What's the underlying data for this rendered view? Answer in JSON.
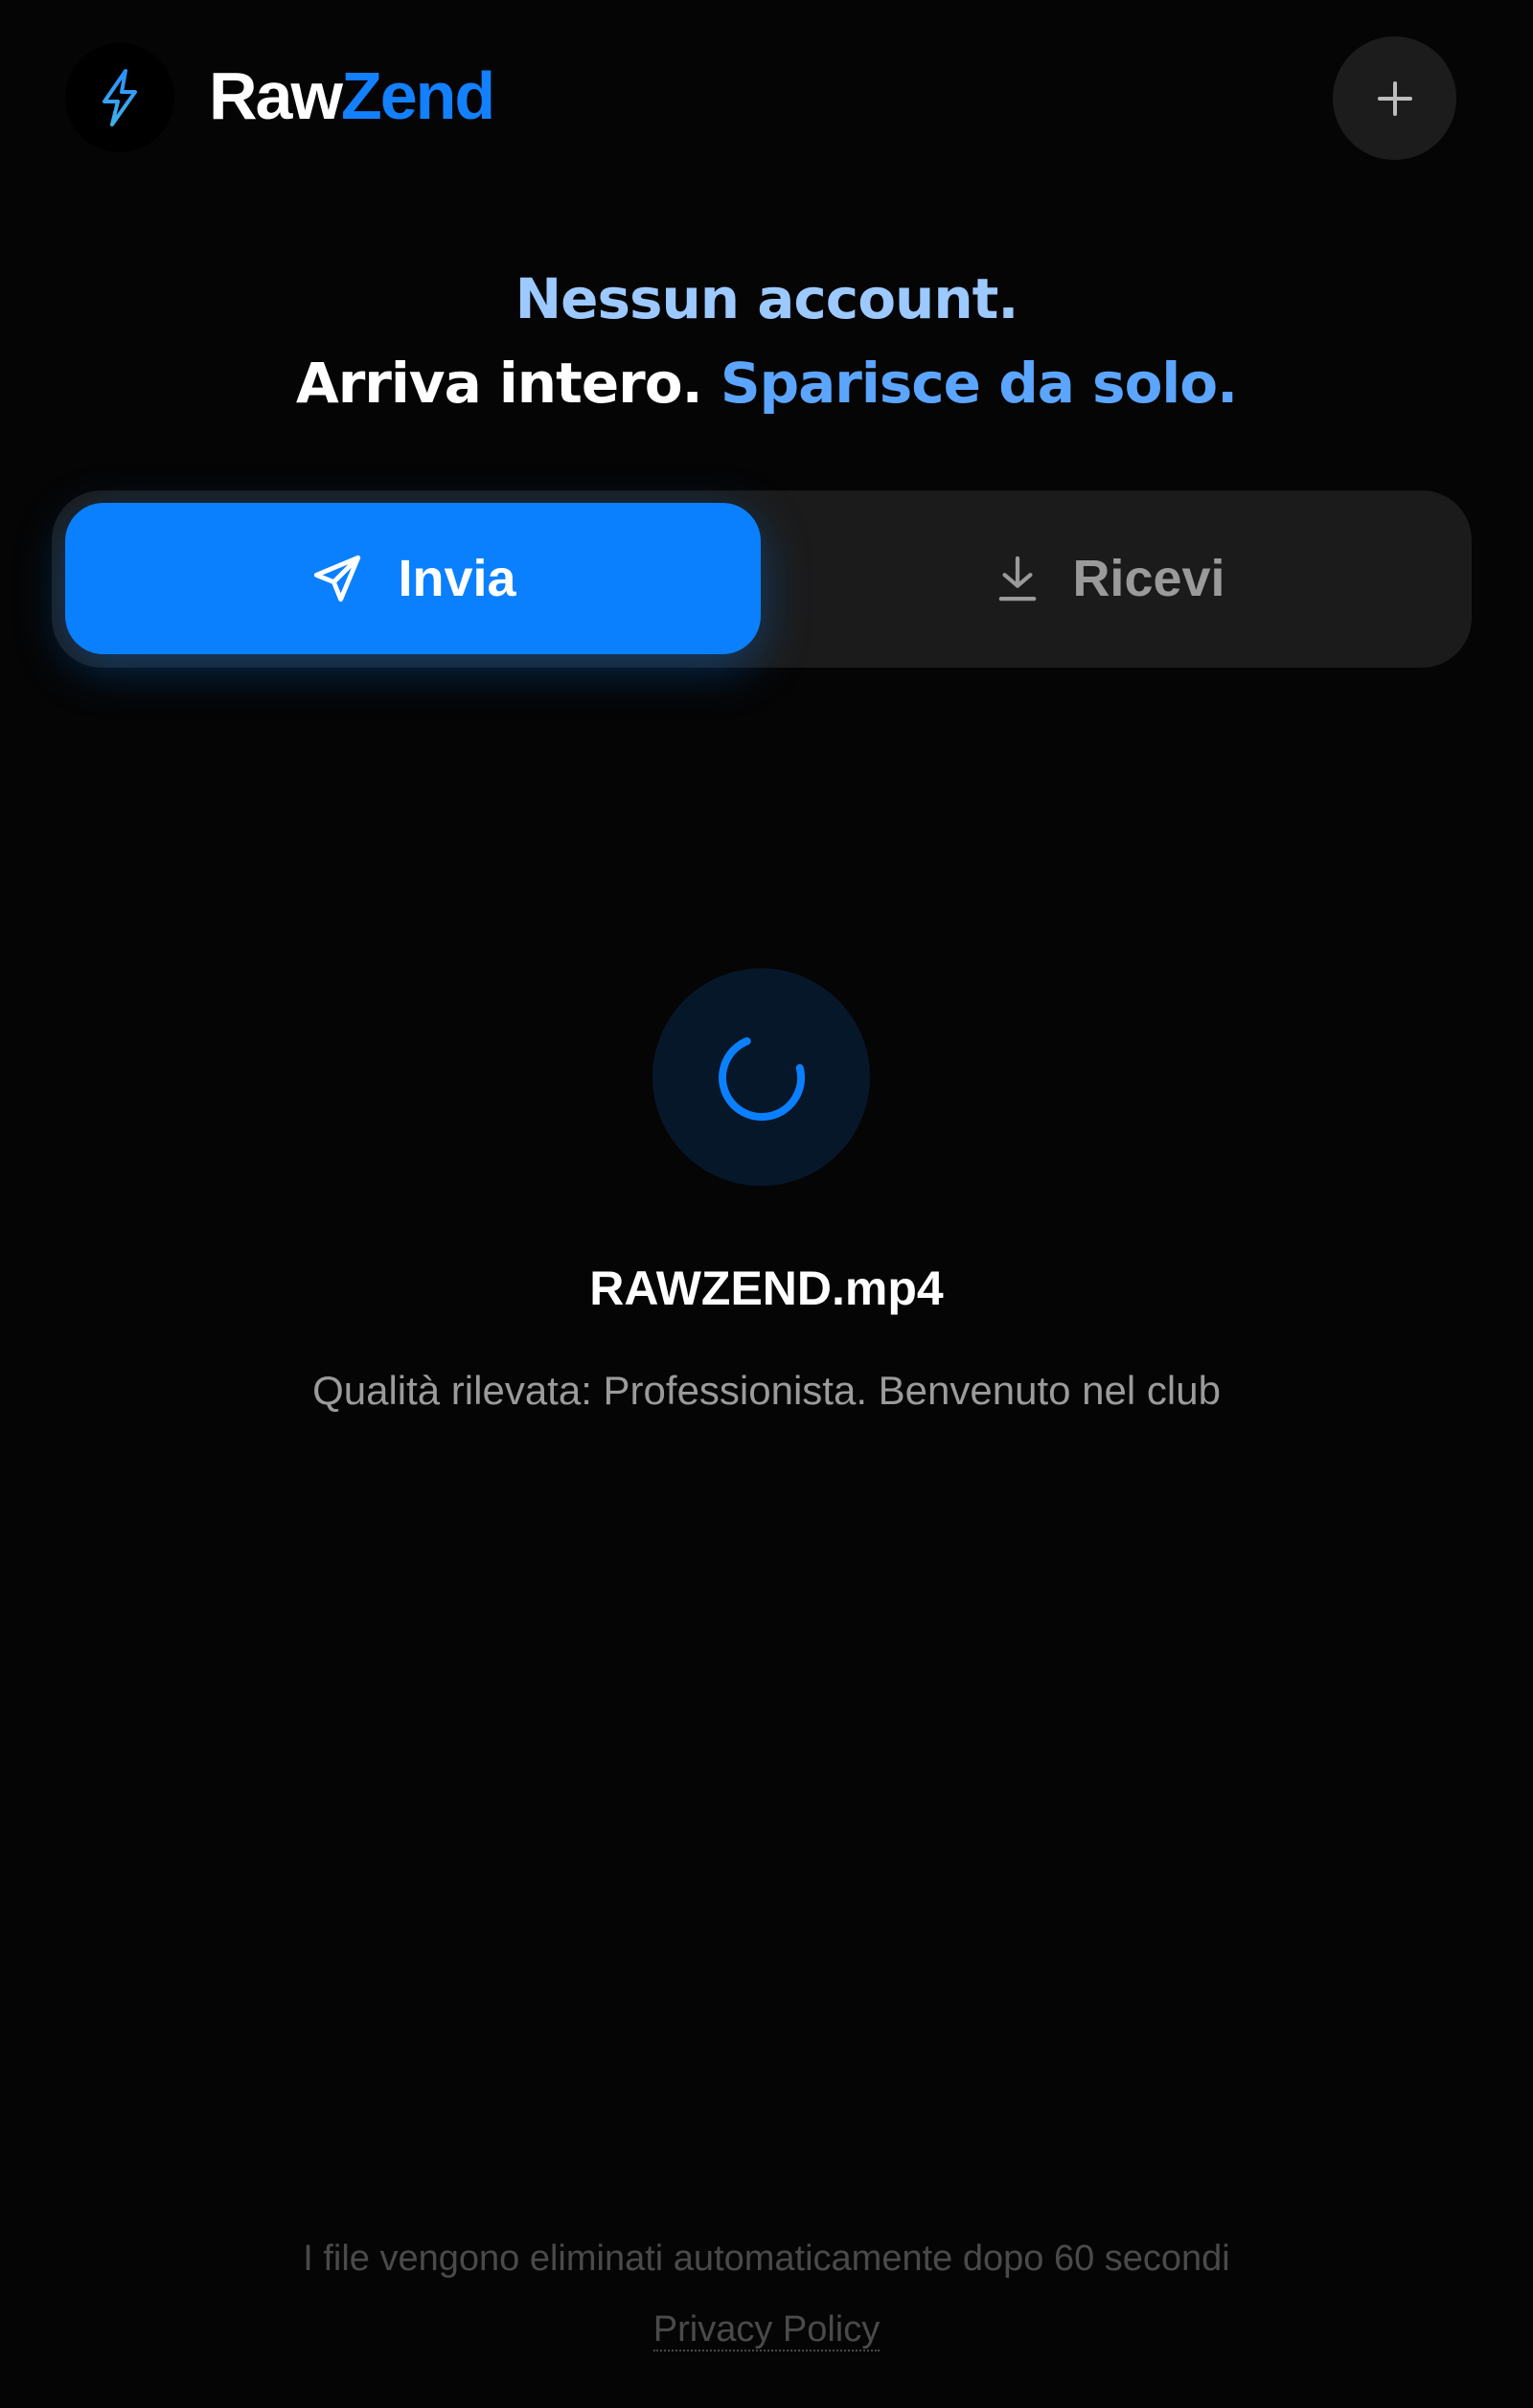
{
  "header": {
    "brand_part1": "Raw",
    "brand_part2": "Zend",
    "logo_icon": "lightning-bolt-icon",
    "action_icon": "plus-icon"
  },
  "tagline": {
    "line1": "Nessun account.",
    "line2_white": "Arriva intero.",
    "line2_blue": "Sparisce da solo."
  },
  "tabs": {
    "send_label": "Invia",
    "send_icon": "send-icon",
    "receive_label": "Ricevi",
    "receive_icon": "download-icon",
    "active": "send"
  },
  "transfer": {
    "icon": "spinner-icon",
    "file_name": "RAWZEND.mp4",
    "status": "Qualità rilevata: Professionista. Benvenuto nel club"
  },
  "footer": {
    "note": "I file vengono eliminati automaticamente dopo 60 secondi",
    "privacy_label": "Privacy Policy"
  },
  "colors": {
    "background": "#050505",
    "accent": "#0a80ff",
    "brand_blue": "#1380ff",
    "tagline_light_blue": "#9cc9ff",
    "tagline_blue": "#5ba5ff",
    "segment_bg": "#1b1b1b",
    "muted_text": "#9b9b9b"
  }
}
